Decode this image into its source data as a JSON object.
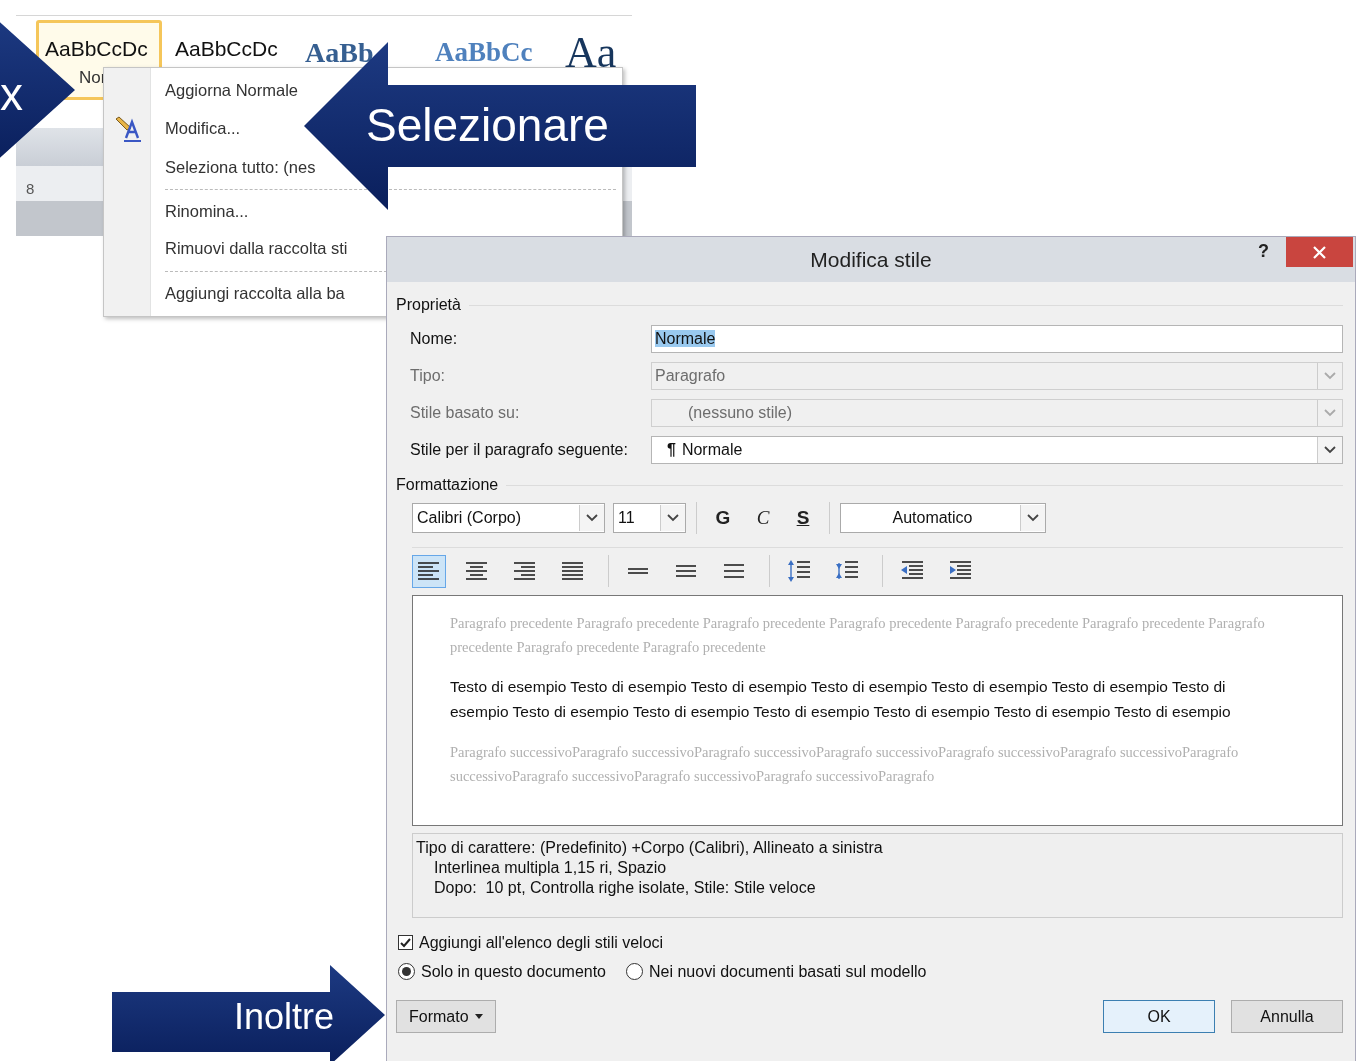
{
  "ribbon": {
    "styles": [
      {
        "sample": "AaBbCcDc",
        "kind": "body",
        "selected": true,
        "label": "Nor"
      },
      {
        "sample": "AaBbCcDc",
        "kind": "body",
        "selected": false
      },
      {
        "sample": "AaBb",
        "kind": "heading1",
        "selected": false
      },
      {
        "sample": "AaBbCc",
        "kind": "heading2",
        "selected": false
      },
      {
        "sample": "Aa",
        "kind": "title",
        "selected": false
      }
    ],
    "ruler_mark": "8"
  },
  "context_menu": {
    "items": [
      {
        "label": "Aggiorna Normale",
        "kind": "item"
      },
      {
        "label": "Modifica...",
        "kind": "icon-item"
      },
      {
        "label": "Seleziona tutto: (nes",
        "kind": "item"
      },
      {
        "kind": "separator"
      },
      {
        "label": "Rinomina...",
        "kind": "item"
      },
      {
        "label": "Rimuovi dalla raccolta sti",
        "kind": "item"
      },
      {
        "kind": "separator"
      },
      {
        "label": "Aggiungi raccolta alla ba",
        "kind": "item"
      }
    ]
  },
  "dialog": {
    "title": "Modifica stile",
    "help": "?",
    "properties": {
      "heading": "Proprietà",
      "fields": [
        {
          "label": "Nome:",
          "value": "Normale",
          "kind": "text",
          "disabled": false,
          "text_selected": true
        },
        {
          "label": "Tipo:",
          "value": "Paragrafo",
          "kind": "select",
          "disabled": true
        },
        {
          "label": "Stile basato su:",
          "value": "(nessuno stile)",
          "kind": "select",
          "disabled": true
        },
        {
          "label": "Stile per il paragrafo seguente:",
          "value": "Normale",
          "glyph": "¶",
          "kind": "select",
          "disabled": false
        }
      ]
    },
    "formatting": {
      "heading": "Formattazione",
      "font": "Calibri (Corpo)",
      "size": "11",
      "styles": [
        {
          "label": "G",
          "kind": "bold"
        },
        {
          "label": "C",
          "kind": "italic"
        },
        {
          "label": "S",
          "kind": "underline"
        }
      ],
      "text_color_option": "Automatico",
      "paragraph_buttons": [
        {
          "kind": "align-left",
          "selected": true
        },
        {
          "kind": "align-center",
          "selected": false
        },
        {
          "kind": "align-right",
          "selected": false
        },
        {
          "kind": "justify",
          "selected": false
        },
        {
          "kind": "spacing-single",
          "selected": false
        },
        {
          "kind": "spacing-medium",
          "selected": false
        },
        {
          "kind": "spacing-double",
          "selected": false
        },
        {
          "kind": "space-increase",
          "selected": false
        },
        {
          "kind": "space-decrease",
          "selected": false
        },
        {
          "kind": "indent-decrease",
          "selected": false
        },
        {
          "kind": "indent-increase",
          "selected": false
        }
      ]
    },
    "preview": {
      "previous": "Paragrafo precedente Paragrafo precedente Paragrafo precedente Paragrafo precedente Paragrafo precedente Paragrafo precedente Paragrafo precedente Paragrafo precedente Paragrafo precedente",
      "sample": "Testo di esempio Testo di esempio Testo di esempio Testo di esempio Testo di esempio Testo di esempio Testo di esempio Testo di esempio Testo di esempio Testo di esempio Testo di esempio Testo di esempio Testo di esempio",
      "next": "Paragrafo successivoParagrafo successivoParagrafo successivoParagrafo successivoParagrafo successivoParagrafo successivoParagrafo successivoParagrafo successivoParagrafo successivoParagrafo successivoParagrafo"
    },
    "description": [
      "Tipo di carattere: (Predefinito) +Corpo (Calibri), Allineato a sinistra",
      "Interlinea multipla 1,15 ri, Spazio",
      "Dopo:  10 pt, Controlla righe isolate, Stile: Stile veloce"
    ],
    "quick_styles": {
      "label": "Aggiungi all'elenco degli stili veloci",
      "checked": true
    },
    "scope": [
      {
        "label": "Solo in questo documento",
        "selected": true
      },
      {
        "label": "Nei nuovi documenti basati sul modello",
        "selected": false
      }
    ],
    "format_button": "Formato",
    "ok": "OK",
    "cancel": "Annulla"
  },
  "callouts": [
    {
      "text": "x",
      "kind": "arrow-right"
    },
    {
      "text": "Selezionare",
      "kind": "arrow-left"
    },
    {
      "text": "Inoltre",
      "kind": "arrow-right"
    }
  ]
}
